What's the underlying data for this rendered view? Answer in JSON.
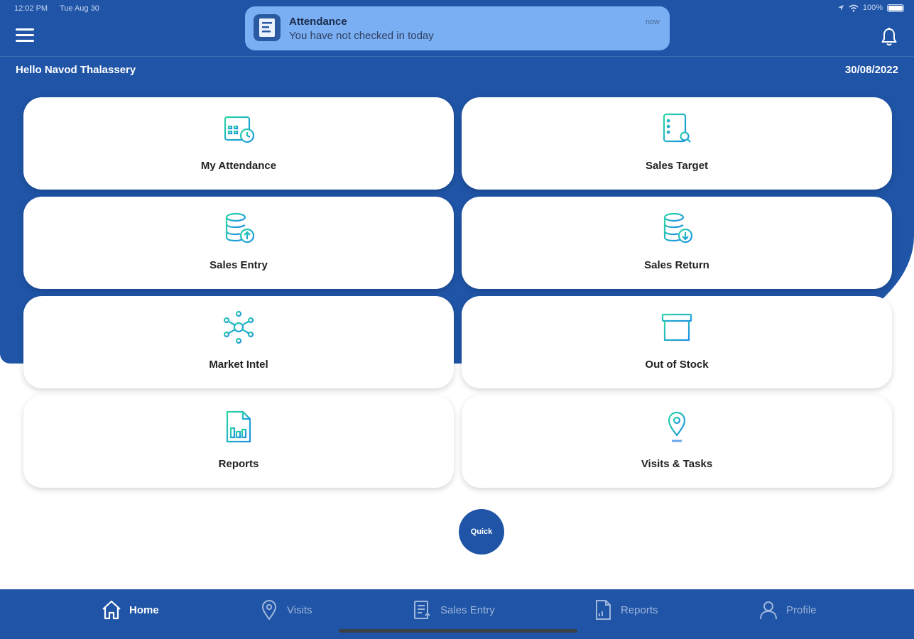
{
  "status_bar": {
    "time": "12:02 PM",
    "date": "Tue Aug 30",
    "battery": "100%"
  },
  "header": {
    "greeting": "Hello Navod Thalassery",
    "date": "30/08/2022"
  },
  "notification": {
    "title": "Attendance",
    "body": "You have not checked in today",
    "time": "now"
  },
  "tiles": [
    {
      "label": "My Attendance",
      "icon": "calendar-clock-icon"
    },
    {
      "label": "Sales Target",
      "icon": "list-search-icon"
    },
    {
      "label": "Sales Entry",
      "icon": "database-upload-icon"
    },
    {
      "label": "Sales Return",
      "icon": "database-download-icon"
    },
    {
      "label": "Market Intel",
      "icon": "network-icon"
    },
    {
      "label": "Out of Stock",
      "icon": "archive-box-icon"
    },
    {
      "label": "Reports",
      "icon": "report-chart-icon"
    },
    {
      "label": "Visits & Tasks",
      "icon": "map-pin-icon"
    }
  ],
  "quick_button": {
    "label": "Quick"
  },
  "bottom_nav": [
    {
      "label": "Home",
      "icon": "home-icon",
      "active": true
    },
    {
      "label": "Visits",
      "icon": "map-pin-icon"
    },
    {
      "label": "Sales Entry",
      "icon": "sales-entry-icon"
    },
    {
      "label": "Reports",
      "icon": "document-icon"
    },
    {
      "label": "Profile",
      "icon": "user-icon"
    }
  ],
  "colors": {
    "primary": "#1f54a6",
    "notification": "#7aaff4",
    "icon_gradient_start": "#2bd6a4",
    "icon_gradient_end": "#1c8fe6",
    "nav_inactive": "#9fb6dc"
  }
}
